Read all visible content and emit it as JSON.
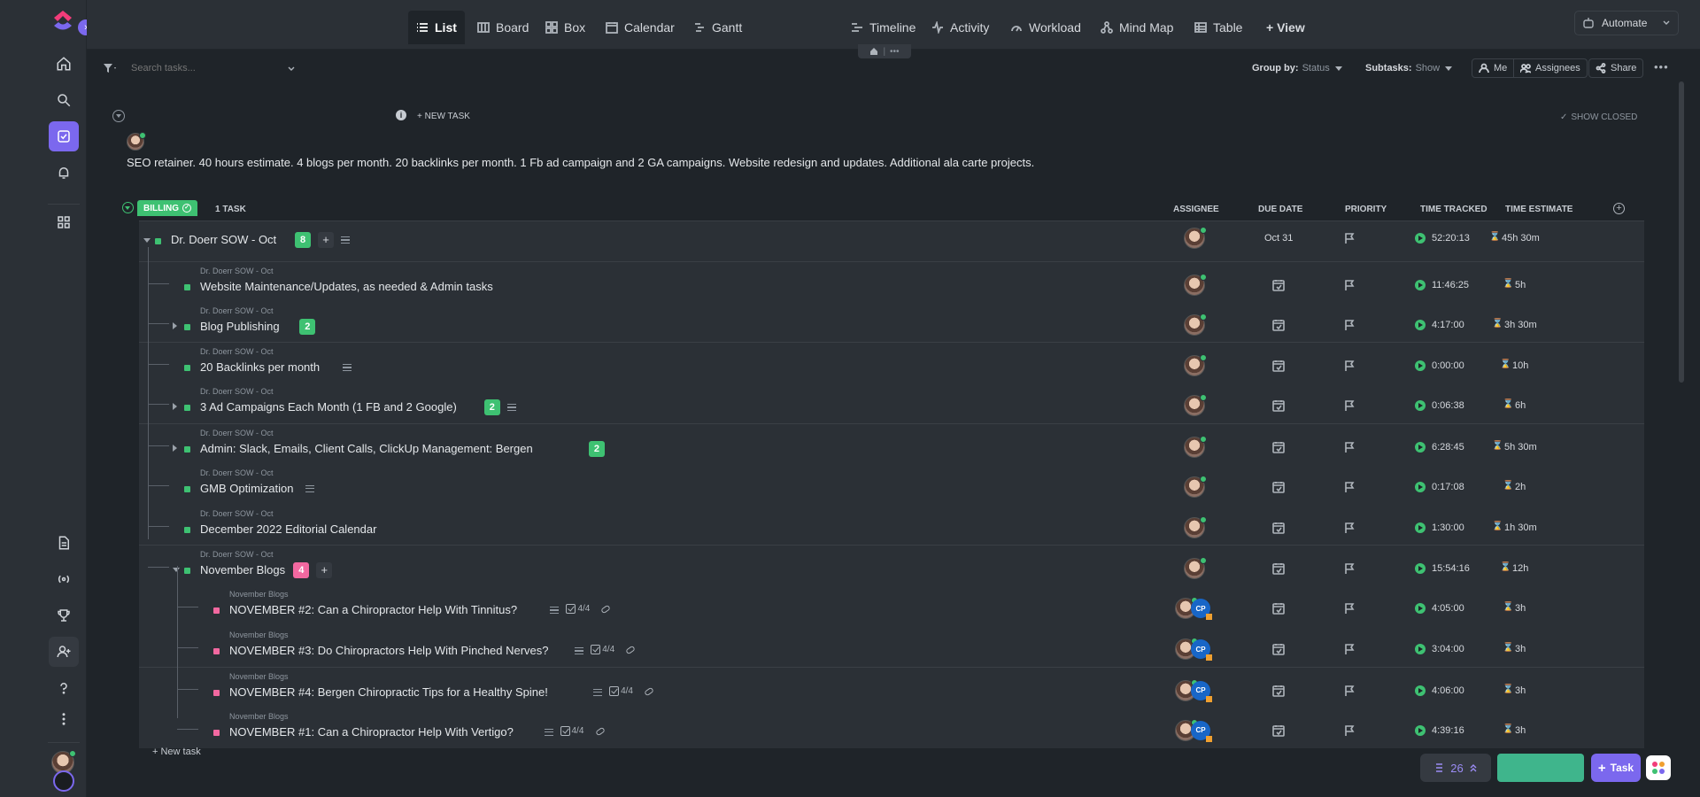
{
  "views": {
    "list": "List",
    "board": "Board",
    "box": "Box",
    "calendar": "Calendar",
    "gantt": "Gantt",
    "timeline": "Timeline",
    "activity": "Activity",
    "workload": "Workload",
    "mindmap": "Mind Map",
    "table": "Table",
    "add_view": "+ View"
  },
  "automate": "Automate",
  "toolbar": {
    "search_placeholder": "Search tasks...",
    "group_by_label": "Group by:",
    "group_by_value": "Status",
    "subtasks_label": "Subtasks:",
    "subtasks_value": "Show",
    "me": "Me",
    "assignees": "Assignees",
    "share": "Share"
  },
  "list_header": {
    "new_task": "+ NEW TASK",
    "show_closed": "SHOW CLOSED",
    "description": "SEO retainer. 40 hours estimate. 4 blogs per month. 20 backlinks per month. 1 Fb ad campaign and 2 GA campaigns. Website redesign and updates. Additional ala carte projects."
  },
  "group": {
    "status": "BILLING",
    "count": "1 TASK",
    "columns": {
      "assignee": "ASSIGNEE",
      "due": "DUE DATE",
      "priority": "PRIORITY",
      "tracked": "TIME TRACKED",
      "estimate": "TIME ESTIMATE"
    }
  },
  "rows": [
    {
      "parent": "",
      "name": "Dr. Doerr SOW - Oct",
      "badge": "8",
      "due": "Oct 31",
      "tracked": "52:20:13",
      "estimate": "45h 30m"
    },
    {
      "parent": "Dr. Doerr SOW - Oct",
      "name": "Website Maintenance/Updates, as needed & Admin tasks",
      "badge": "",
      "due": "",
      "tracked": "11:46:25",
      "estimate": "5h"
    },
    {
      "parent": "Dr. Doerr SOW - Oct",
      "name": "Blog Publishing",
      "badge": "2",
      "due": "",
      "tracked": "4:17:00",
      "estimate": "3h 30m"
    },
    {
      "parent": "Dr. Doerr SOW - Oct",
      "name": "20 Backlinks per month",
      "badge": "",
      "due": "",
      "tracked": "0:00:00",
      "estimate": "10h"
    },
    {
      "parent": "Dr. Doerr SOW - Oct",
      "name": "3 Ad Campaigns Each Month (1 FB and 2 Google)",
      "badge": "2",
      "due": "",
      "tracked": "0:06:38",
      "estimate": "6h"
    },
    {
      "parent": "Dr. Doerr SOW - Oct",
      "name": "Admin: Slack, Emails, Client Calls, ClickUp Management: Bergen",
      "badge": "2",
      "due": "",
      "tracked": "6:28:45",
      "estimate": "5h 30m"
    },
    {
      "parent": "Dr. Doerr SOW - Oct",
      "name": "GMB Optimization",
      "badge": "",
      "due": "",
      "tracked": "0:17:08",
      "estimate": "2h"
    },
    {
      "parent": "Dr. Doerr SOW - Oct",
      "name": "December 2022 Editorial Calendar",
      "badge": "",
      "due": "",
      "tracked": "1:30:00",
      "estimate": "1h 30m"
    },
    {
      "parent": "Dr. Doerr SOW - Oct",
      "name": "November Blogs",
      "badge": "4",
      "due": "",
      "tracked": "15:54:16",
      "estimate": "12h"
    },
    {
      "parent": "November Blogs",
      "name": "NOVEMBER #2: Can a Chiropractor Help With Tinnitus?",
      "badge": "",
      "checklist": "4/4",
      "due": "",
      "tracked": "4:05:00",
      "estimate": "3h"
    },
    {
      "parent": "November Blogs",
      "name": "NOVEMBER #3: Do Chiropractors Help With Pinched Nerves?",
      "badge": "",
      "checklist": "4/4",
      "due": "",
      "tracked": "3:04:00",
      "estimate": "3h"
    },
    {
      "parent": "November Blogs",
      "name": "NOVEMBER #4: Bergen Chiropractic Tips for a Healthy Spine!",
      "badge": "",
      "checklist": "4/4",
      "due": "",
      "tracked": "4:06:00",
      "estimate": "3h"
    },
    {
      "parent": "November Blogs",
      "name": "NOVEMBER #1: Can a Chiropractor Help With Vertigo?",
      "badge": "",
      "checklist": "4/4",
      "due": "",
      "tracked": "4:39:16",
      "estimate": "3h"
    }
  ],
  "new_task_footer": "+ New task",
  "bottom": {
    "count": "26",
    "task_button": "Task"
  },
  "avatar_initials": "CP",
  "colors": {
    "accent": "#7b68ee",
    "status_green": "#3ec172",
    "status_pink": "#f268a0",
    "bg": "#1f2429",
    "panel": "#2b3036"
  }
}
